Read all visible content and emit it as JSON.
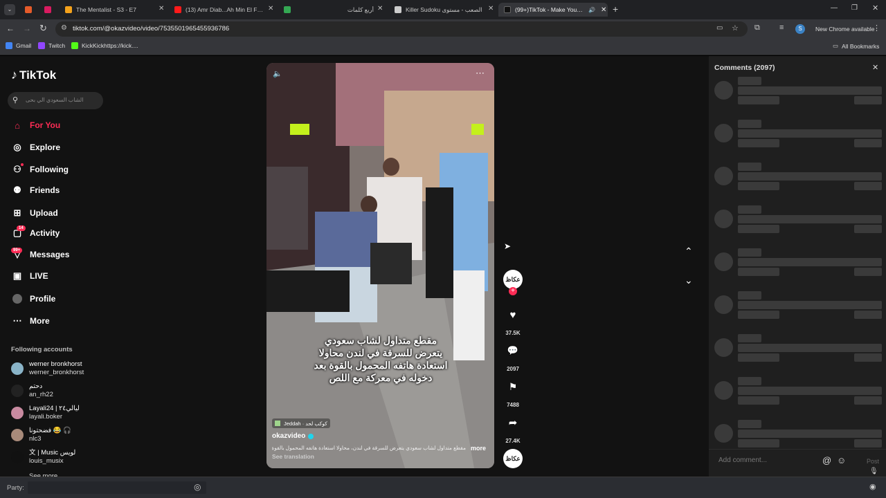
{
  "browser": {
    "tabs": [
      {
        "title": "",
        "color": "#e9e9e9"
      },
      {
        "title": "",
        "color": "#e55b2a"
      },
      {
        "title": "",
        "color": "#d81b60"
      },
      {
        "title": "The Mentalist - S3 - E7",
        "color": "#f4a21c"
      },
      {
        "title": "(13) Amr Diab...Ah Min El Forae",
        "color": "#ff1a1a"
      },
      {
        "title": "",
        "color": "#34a853"
      },
      {
        "title": "أربع كلمات",
        "color": "#ffffff"
      },
      {
        "title": "Killer Sudoku الصعب - مستوى",
        "color": "#cccccc"
      },
      {
        "title": "(99+)TikTok - Make Your Da...",
        "color": "#111111"
      }
    ],
    "url": "tiktok.com/@okazvideo/video/7535501965455936786",
    "new_chrome": "New Chrome available",
    "profile_initial": "S",
    "bookmarks": [
      {
        "label": "Gmail",
        "color": "#4285f4"
      },
      {
        "label": "Twitch",
        "color": "#9146ff"
      },
      {
        "label": "KickKickhttps://kick....",
        "color": "#53fc18"
      }
    ],
    "all_bookmarks": "All Bookmarks"
  },
  "sidebar": {
    "logo": "TikTok",
    "search_placeholder": "الشاب السعودي الي بحى",
    "nav": [
      {
        "label": "For You",
        "icon": "home-icon",
        "active": true
      },
      {
        "label": "Explore",
        "icon": "compass-icon"
      },
      {
        "label": "Following",
        "icon": "following-icon"
      },
      {
        "label": "Friends",
        "icon": "friends-icon"
      },
      {
        "label": "Upload",
        "icon": "upload-icon"
      },
      {
        "label": "Activity",
        "icon": "activity-icon",
        "badge": "14"
      },
      {
        "label": "Messages",
        "icon": "messages-icon",
        "badge": "99+"
      },
      {
        "label": "LIVE",
        "icon": "live-icon"
      },
      {
        "label": "Profile",
        "icon": "profile-icon"
      },
      {
        "label": "More",
        "icon": "more-icon"
      }
    ],
    "following_title": "Following accounts",
    "accounts": [
      {
        "name": "werner bronkhorst",
        "user": "werner_bronkhorst"
      },
      {
        "name": "دحتم",
        "user": "an_rh22"
      },
      {
        "name": "Layali24 | ليالي٢٤",
        "user": "layali.boker"
      },
      {
        "name": "فضحتونا 😂 🎧",
        "user": "nlc3"
      },
      {
        "name": "文 | Music لويس",
        "user": "louis_musix"
      }
    ],
    "see_more": "See more"
  },
  "video": {
    "caption_overlay": "مقطع متداول لشاب سعودي\nيتعرض للسرقة في لندن محاولا\nاستعادة هاتفه المحمول بالقوة بعد\nدخوله في معركة مع اللص",
    "location": "Jeddah · كوكب لحد",
    "author": "okazvideo",
    "description": "مقطع متداول لشاب سعودي يتعرض للسرقة في لندن، محاولا استعادة هاتفه المحمول بالقوة بعد...",
    "more": "more",
    "see_translation": "See translation"
  },
  "actions": {
    "likes": "37.5K",
    "comments": "2097",
    "saves": "7488",
    "shares": "27.4K",
    "avatar_label": "عكاظ"
  },
  "comments_panel": {
    "title": "Comments (2097)",
    "add_placeholder": "Add comment...",
    "post": "Post"
  },
  "bottom": {
    "party_label": "Party:"
  }
}
